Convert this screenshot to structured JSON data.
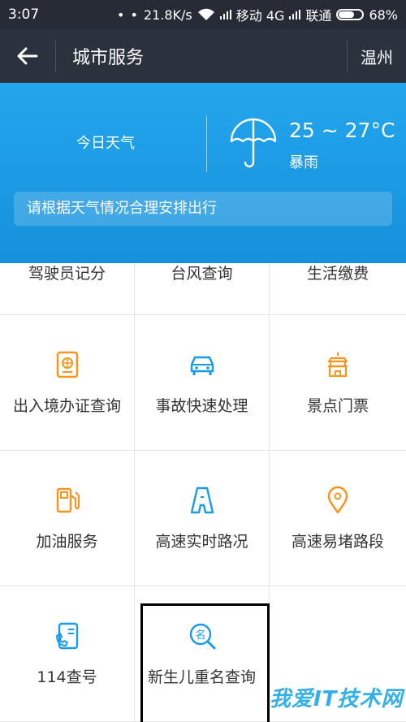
{
  "status_bar": {
    "time": "3:07",
    "dots": "• •",
    "speed": "21.8K/s",
    "carrier1": "移动 4G",
    "carrier2": "联通",
    "battery": "68%",
    "battery_level": 0.68
  },
  "header": {
    "title": "城市服务",
    "city": "温州",
    "back_icon": "arrow-left-icon"
  },
  "weather": {
    "today_label": "今日天气",
    "temperature": "25 ~ 27°C",
    "condition": "暴雨",
    "tip": "请根据天气情况合理安排出行",
    "icon": "umbrella-icon"
  },
  "services": {
    "row0": [
      "驾驶员记分",
      "台风查询",
      "生活缴费"
    ],
    "row1": [
      "出入境办证查询",
      "事故快速处理",
      "景点门票"
    ],
    "row2": [
      "加油服务",
      "高速实时路况",
      "高速易堵路段"
    ],
    "row3": [
      "114查号",
      "新生儿重名查询"
    ]
  },
  "colors": {
    "accent_blue": "#1a9be8",
    "accent_orange": "#f5961e",
    "header_bg": "#2b313d"
  },
  "watermark": "我爱IT技术网"
}
